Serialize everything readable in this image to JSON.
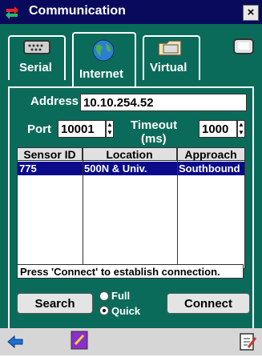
{
  "window": {
    "title": "Communication",
    "close_glyph": "×"
  },
  "tabs": [
    {
      "label": "Serial",
      "icon": "serial-port-icon"
    },
    {
      "label": "Internet",
      "icon": "globe-icon"
    },
    {
      "label": "Virtual",
      "icon": "folder-icon"
    }
  ],
  "form": {
    "address_label": "Address",
    "address_value": "10.10.254.52",
    "port_label": "Port",
    "port_value": "10001",
    "timeout_label": "Timeout",
    "timeout_unit": "(ms)",
    "timeout_value": "1000"
  },
  "table": {
    "headers": [
      "Sensor ID",
      "Location",
      "Approach"
    ],
    "rows": [
      [
        "775",
        "500N & Univ.",
        "Southbound"
      ]
    ]
  },
  "status_text": "Press 'Connect' to establish connection.",
  "search_button": "Search",
  "radio": {
    "full": "Full",
    "quick": "Quick",
    "selected": "Quick"
  },
  "connect_button": "Connect",
  "colors": {
    "background": "#0b6b5a",
    "titlebar": "#0a0a5c",
    "selection": "#0a0a8a"
  }
}
